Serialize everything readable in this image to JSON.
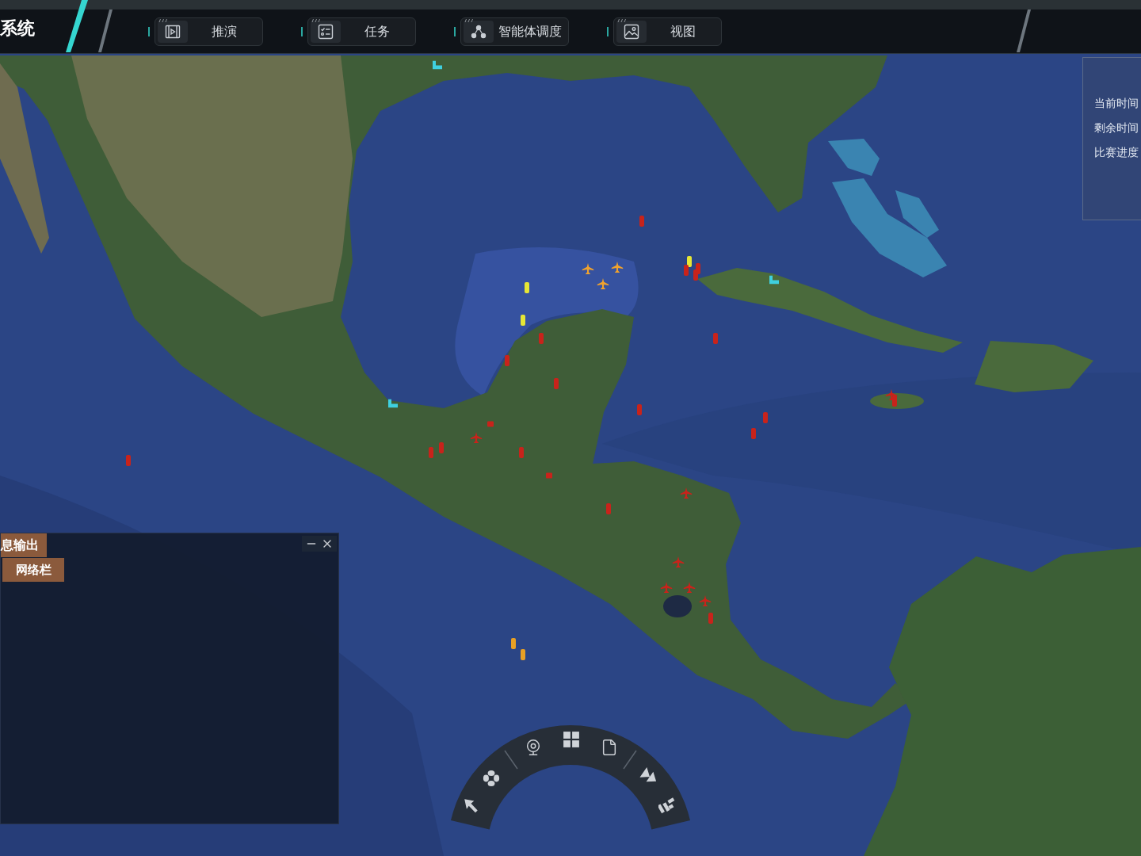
{
  "header": {
    "title": "系统"
  },
  "menu": [
    {
      "label": "推演"
    },
    {
      "label": "任务"
    },
    {
      "label": "智能体调度"
    },
    {
      "label": "视图"
    }
  ],
  "status_panel": {
    "lines": [
      "当前时间",
      "剩余时间",
      "比赛进度"
    ]
  },
  "output_panel": {
    "title": "息输出",
    "tabs": [
      {
        "label": "网络栏"
      }
    ]
  },
  "map": {
    "markers": [
      {
        "kind": "base",
        "color": "#3fd0e0"
      },
      {
        "kind": "base",
        "color": "#3fd0e0"
      },
      {
        "kind": "base",
        "color": "#3fd0e0"
      },
      {
        "kind": "ship",
        "color": "#c8231b"
      },
      {
        "kind": "plane",
        "color": "#f0a22e"
      },
      {
        "kind": "plane",
        "color": "#f0a22e"
      },
      {
        "kind": "plane",
        "color": "#f0a22e"
      },
      {
        "kind": "ship",
        "color": "#e6e635"
      },
      {
        "kind": "ship",
        "color": "#e6e635"
      },
      {
        "kind": "ship",
        "color": "#e6e635"
      },
      {
        "kind": "ship",
        "color": "#c8231b"
      },
      {
        "kind": "ship",
        "color": "#c8231b"
      },
      {
        "kind": "ship",
        "color": "#c8231b"
      },
      {
        "kind": "ship",
        "color": "#c8231b"
      },
      {
        "kind": "ship",
        "color": "#c8231b"
      },
      {
        "kind": "ship",
        "color": "#c8231b"
      },
      {
        "kind": "ship",
        "color": "#c8231b"
      },
      {
        "kind": "ship",
        "color": "#c8231b"
      },
      {
        "kind": "ship",
        "color": "#c8231b"
      },
      {
        "kind": "ship",
        "color": "#c8231b"
      },
      {
        "kind": "plane",
        "color": "#c8231b"
      },
      {
        "kind": "ship",
        "color": "#c8231b"
      },
      {
        "kind": "vehicle",
        "color": "#c8231b"
      },
      {
        "kind": "plane",
        "color": "#c8231b"
      },
      {
        "kind": "ship",
        "color": "#c8231b"
      },
      {
        "kind": "ship",
        "color": "#c8231b"
      },
      {
        "kind": "ship",
        "color": "#c8231b"
      },
      {
        "kind": "vehicle",
        "color": "#c8231b"
      },
      {
        "kind": "ship",
        "color": "#c8231b"
      },
      {
        "kind": "ship",
        "color": "#c8231b"
      },
      {
        "kind": "plane",
        "color": "#c8231b"
      },
      {
        "kind": "plane",
        "color": "#c8231b"
      },
      {
        "kind": "plane",
        "color": "#c8231b"
      },
      {
        "kind": "plane",
        "color": "#c8231b"
      },
      {
        "kind": "plane",
        "color": "#c8231b"
      },
      {
        "kind": "ship",
        "color": "#c8231b"
      },
      {
        "kind": "ship",
        "color": "#e8a024"
      },
      {
        "kind": "ship",
        "color": "#e8a024"
      }
    ]
  }
}
